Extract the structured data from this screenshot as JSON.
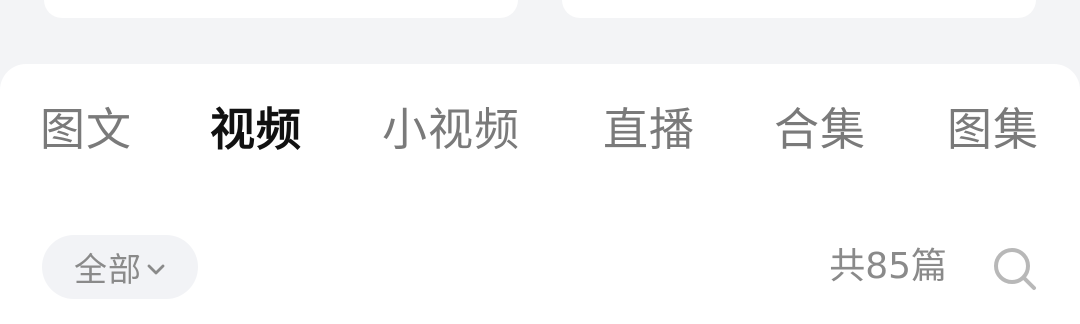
{
  "tabs": [
    {
      "label": "图文",
      "active": false
    },
    {
      "label": "视频",
      "active": true
    },
    {
      "label": "小视频",
      "active": false
    },
    {
      "label": "直播",
      "active": false
    },
    {
      "label": "合集",
      "active": false
    },
    {
      "label": "图集",
      "active": false
    }
  ],
  "filter": {
    "selected": "全部",
    "icon": "chevron-down-icon"
  },
  "count": "共85篇",
  "search": {
    "icon": "search-icon"
  },
  "colors": {
    "background": "#f3f4f6",
    "surface": "#ffffff",
    "tab_active": "#111111",
    "tab_inactive": "#7a7a7a",
    "muted_text": "#8a8a8a",
    "chip_bg": "#f2f3f6",
    "icon": "#b8b8b8"
  }
}
